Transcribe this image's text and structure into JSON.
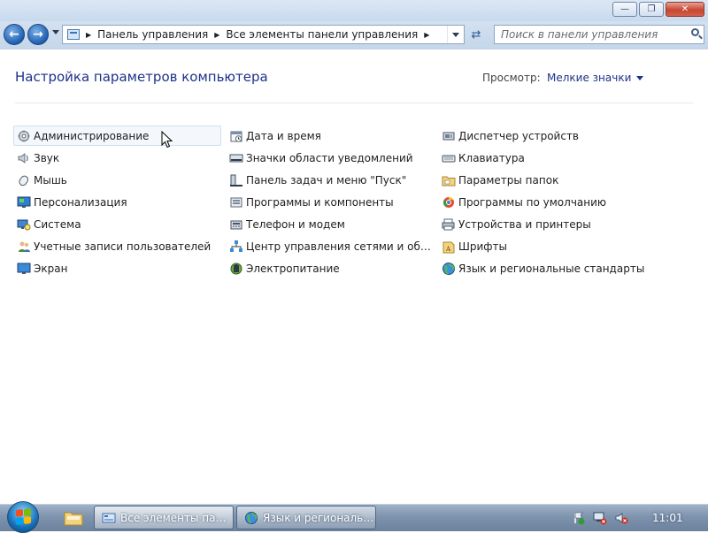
{
  "window": {
    "buttons": {
      "minimize": "—",
      "maximize": "❐",
      "close": "✕"
    }
  },
  "nav": {
    "back_icon": "back-arrow-icon",
    "forward_icon": "forward-arrow-icon",
    "breadcrumbs": [
      "Панель управления",
      "Все элементы панели управления"
    ],
    "search_placeholder": "Поиск в панели управления"
  },
  "content": {
    "title": "Настройка параметров компьютера",
    "view_label": "Просмотр:",
    "view_value": "Мелкие значки",
    "columns": [
      [
        {
          "label": "Администрирование",
          "icon": "administrative-tools-icon"
        },
        {
          "label": "Звук",
          "icon": "sound-icon"
        },
        {
          "label": "Мышь",
          "icon": "mouse-icon"
        },
        {
          "label": "Персонализация",
          "icon": "personalization-icon"
        },
        {
          "label": "Система",
          "icon": "system-icon"
        },
        {
          "label": "Учетные записи пользователей",
          "icon": "user-accounts-icon"
        },
        {
          "label": "Экран",
          "icon": "display-icon"
        }
      ],
      [
        {
          "label": "Дата и время",
          "icon": "date-time-icon"
        },
        {
          "label": "Значки области уведомлений",
          "icon": "notification-icons-icon"
        },
        {
          "label": "Панель задач и меню \"Пуск\"",
          "icon": "taskbar-start-menu-icon"
        },
        {
          "label": "Программы и компоненты",
          "icon": "programs-features-icon"
        },
        {
          "label": "Телефон и модем",
          "icon": "phone-modem-icon"
        },
        {
          "label": "Центр управления сетями и общи...",
          "icon": "network-sharing-icon"
        },
        {
          "label": "Электропитание",
          "icon": "power-options-icon"
        }
      ],
      [
        {
          "label": "Диспетчер устройств",
          "icon": "device-manager-icon"
        },
        {
          "label": "Клавиатура",
          "icon": "keyboard-icon"
        },
        {
          "label": "Параметры папок",
          "icon": "folder-options-icon"
        },
        {
          "label": "Программы по умолчанию",
          "icon": "default-programs-icon"
        },
        {
          "label": "Устройства и принтеры",
          "icon": "devices-printers-icon"
        },
        {
          "label": "Шрифты",
          "icon": "fonts-icon"
        },
        {
          "label": "Язык и региональные стандарты",
          "icon": "region-language-icon"
        }
      ]
    ]
  },
  "taskbar": {
    "tasks": [
      {
        "label": "Все элементы пане...",
        "icon": "control-panel-icon"
      },
      {
        "label": "Язык и региональн...",
        "icon": "region-language-icon"
      }
    ],
    "tray_icons": [
      "action-center-icon",
      "network-icon",
      "volume-muted-icon"
    ],
    "clock": "11:01"
  },
  "colors": {
    "title_text": "#1e3287",
    "hover_border": "#cfdeef",
    "taskbar": "#7e93ad"
  }
}
